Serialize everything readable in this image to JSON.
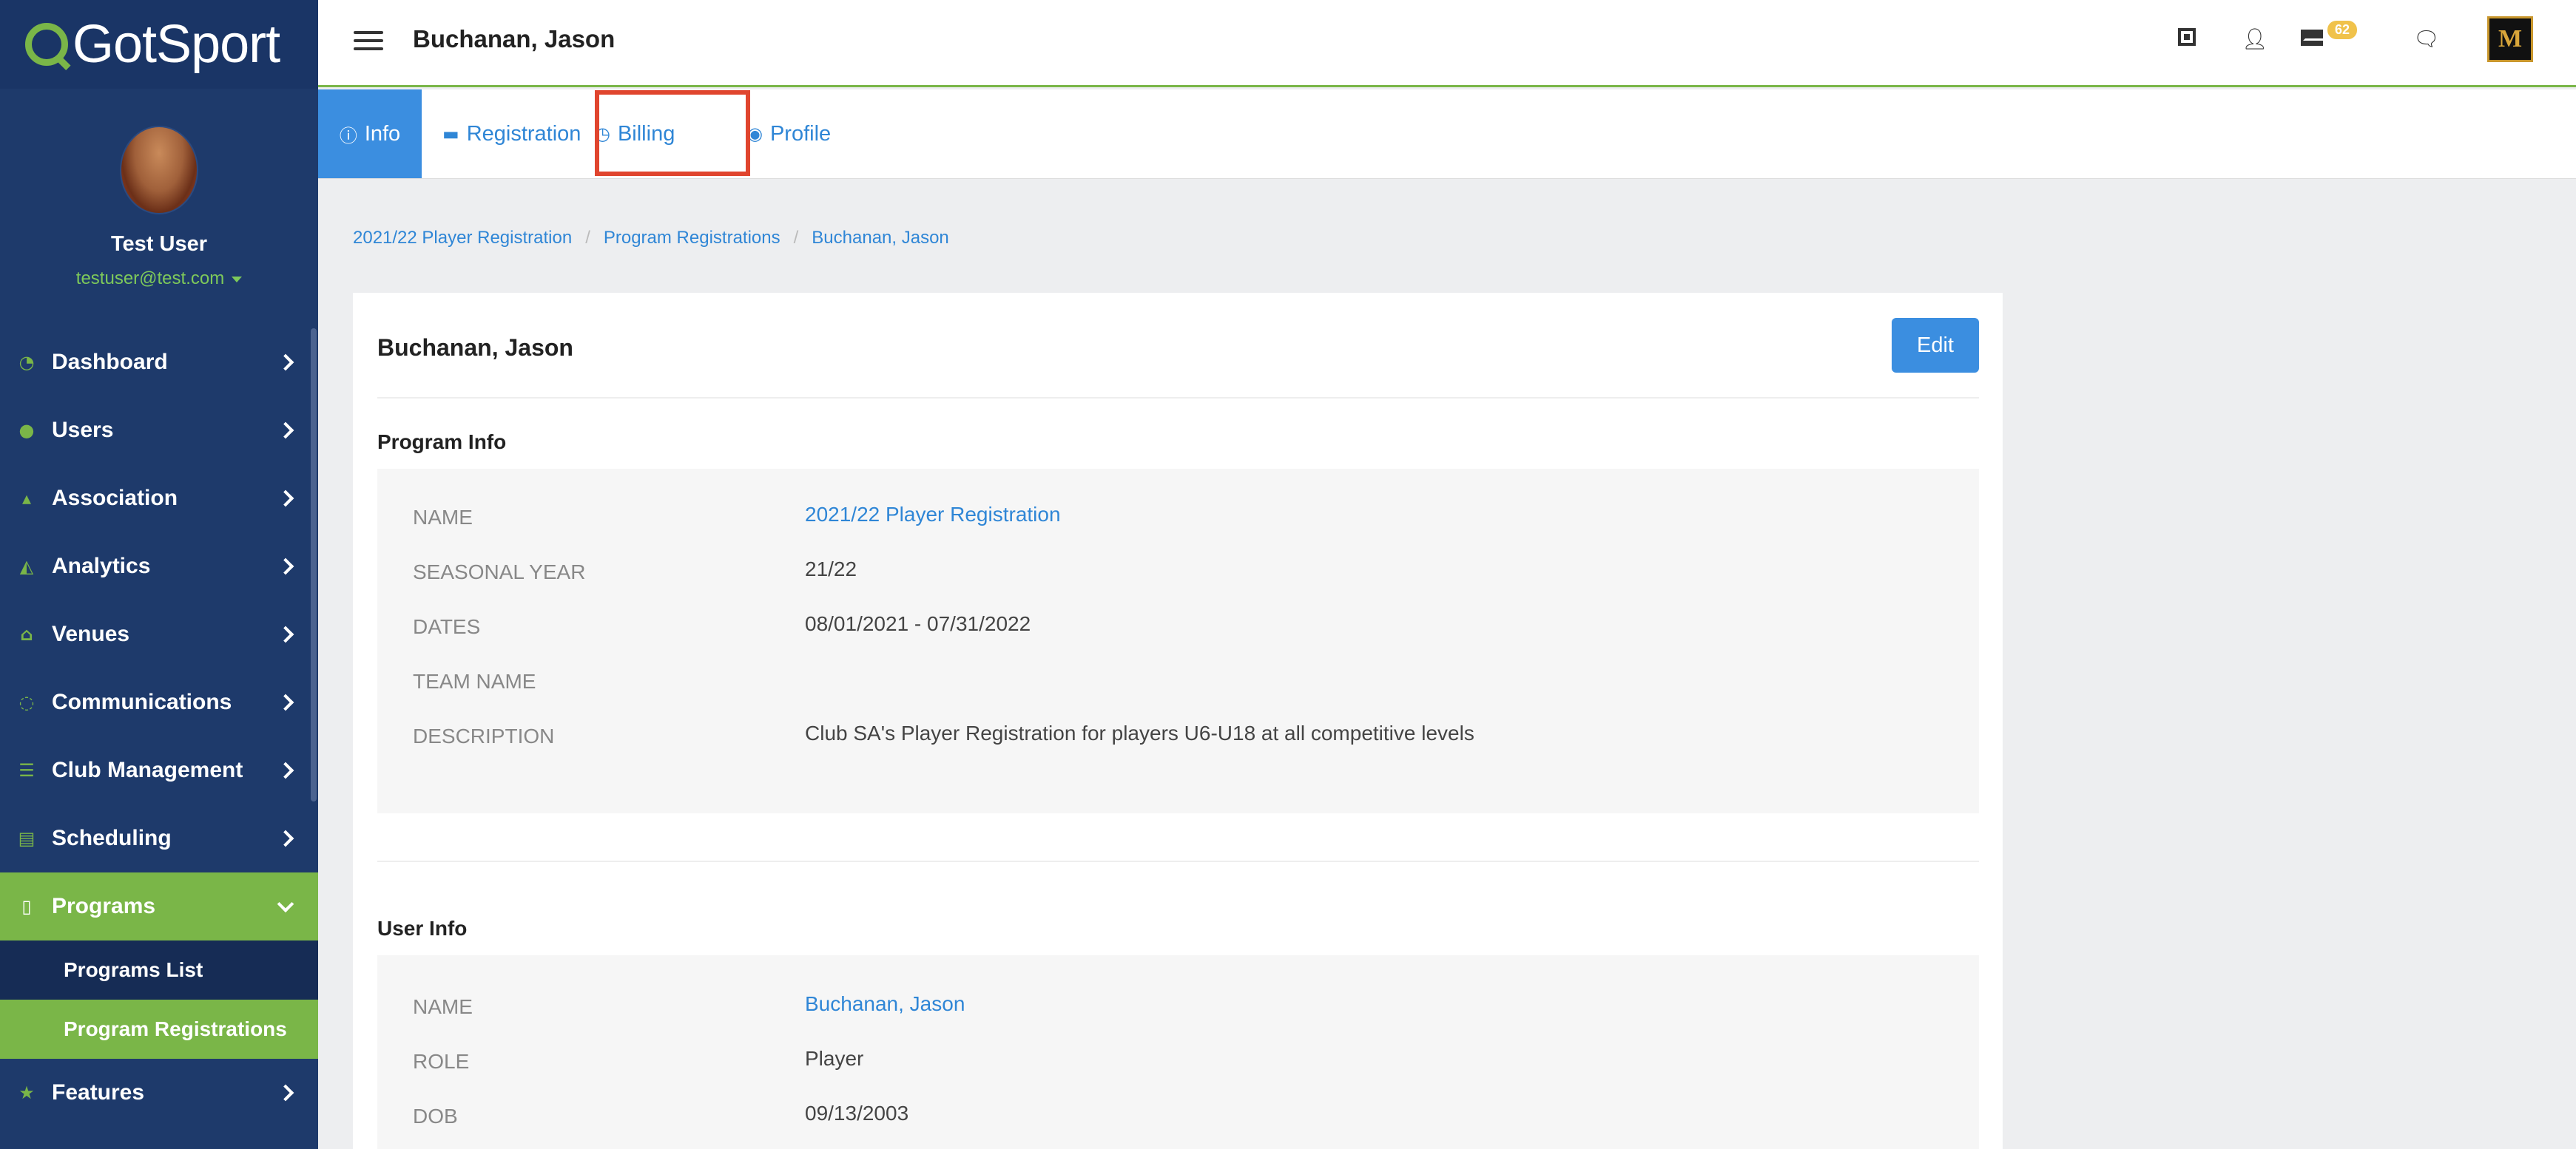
{
  "sidebar": {
    "logo_text": "GotSport",
    "user_name": "Test User",
    "user_email": "testuser@test.com",
    "nav": [
      {
        "label": "Dashboard",
        "icon": "dashboard-icon"
      },
      {
        "label": "Users",
        "icon": "users-icon"
      },
      {
        "label": "Association",
        "icon": "sitemap-icon"
      },
      {
        "label": "Analytics",
        "icon": "area-chart-icon"
      },
      {
        "label": "Venues",
        "icon": "home-icon"
      },
      {
        "label": "Communications",
        "icon": "chat-icon"
      },
      {
        "label": "Club Management",
        "icon": "list-icon"
      },
      {
        "label": "Scheduling",
        "icon": "calendar-icon"
      },
      {
        "label": "Programs",
        "icon": "document-icon"
      },
      {
        "label": "Features",
        "icon": "star-icon"
      }
    ],
    "programs_sub": [
      {
        "label": "Programs List"
      },
      {
        "label": "Program Registrations"
      }
    ]
  },
  "header": {
    "title": "Buchanan, Jason",
    "mail_count": "62"
  },
  "tabs": {
    "info": "Info",
    "registration": "Registration",
    "billing": "Billing",
    "profile": "Profile"
  },
  "breadcrumb": [
    "2021/22 Player Registration",
    "Program Registrations",
    "Buchanan, Jason"
  ],
  "card": {
    "title": "Buchanan, Jason",
    "edit_label": "Edit",
    "program_info": {
      "heading": "Program Info",
      "name_label": "NAME",
      "name_value": "2021/22 Player Registration",
      "year_label": "SEASONAL YEAR",
      "year_value": "21/22",
      "dates_label": "DATES",
      "dates_value": "08/01/2021 - 07/31/2022",
      "team_label": "TEAM NAME",
      "team_value": "",
      "desc_label": "DESCRIPTION",
      "desc_value": "Club SA's Player Registration for players U6-U18 at all competitive levels"
    },
    "user_info": {
      "heading": "User Info",
      "name_label": "NAME",
      "name_value": "Buchanan, Jason",
      "role_label": "ROLE",
      "role_value": "Player",
      "dob_label": "DOB",
      "dob_value": "09/13/2003"
    }
  },
  "colors": {
    "sidebar_bg": "#1e3a6b",
    "accent_green": "#7ab648",
    "primary_blue": "#3b8ee0",
    "highlight_red": "#e0452e"
  }
}
